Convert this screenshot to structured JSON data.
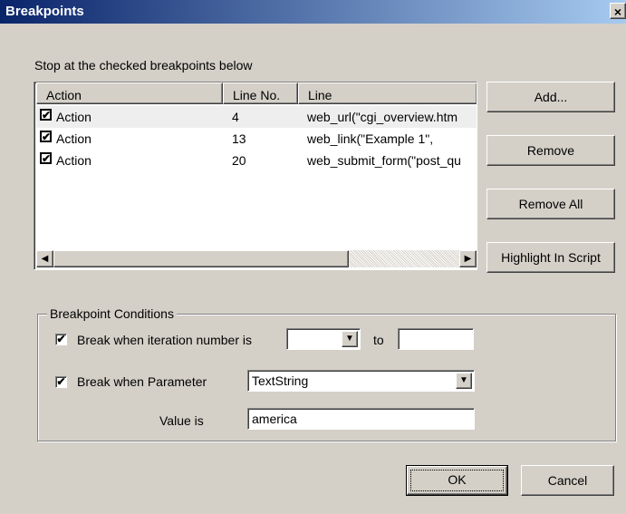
{
  "window": {
    "title": "Breakpoints",
    "close_glyph": "×"
  },
  "instruction": "Stop at the checked breakpoints below",
  "list": {
    "columns": [
      "Action",
      "Line No.",
      "Line"
    ],
    "rows": [
      {
        "checked": true,
        "action": "Action",
        "line_no": "4",
        "line": "web_url(\"cgi_overview.htm"
      },
      {
        "checked": true,
        "action": "Action",
        "line_no": "13",
        "line": "web_link(\"Example 1\","
      },
      {
        "checked": true,
        "action": "Action",
        "line_no": "20",
        "line": "web_submit_form(\"post_qu"
      }
    ],
    "scroll_left_glyph": "◀",
    "scroll_right_glyph": "▶"
  },
  "buttons": {
    "add": "Add...",
    "remove": "Remove",
    "remove_all": "Remove All",
    "highlight": "Highlight In Script",
    "ok": "OK",
    "cancel": "Cancel"
  },
  "conditions": {
    "legend": "Breakpoint Conditions",
    "iteration": {
      "checked": true,
      "label": "Break when iteration number is",
      "from": "",
      "to_label": "to",
      "to": ""
    },
    "parameter": {
      "checked": true,
      "label": "Break when Parameter",
      "value": "TextString"
    },
    "value_is": {
      "label": "Value is",
      "value": "america"
    }
  },
  "icons": {
    "check": "✔",
    "dropdown": "▼"
  },
  "colors": {
    "titlebar_start": "#0a246a",
    "titlebar_end": "#a6caf0",
    "face": "#d4d0c8"
  }
}
